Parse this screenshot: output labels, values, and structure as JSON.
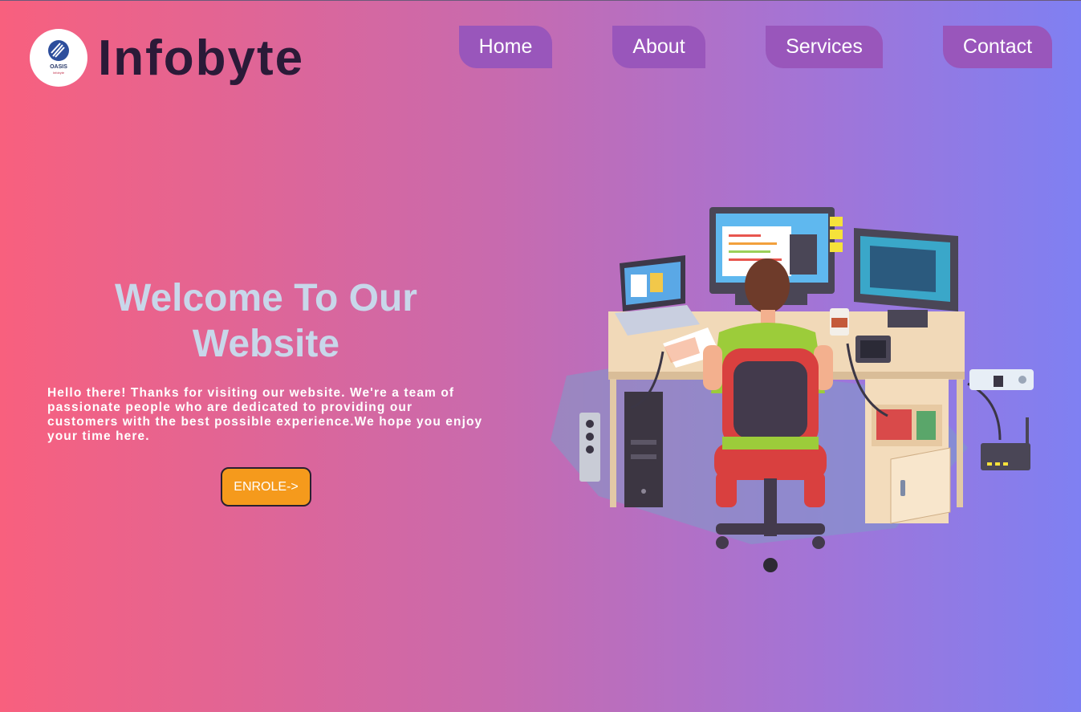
{
  "brand": {
    "name": "Infobyte",
    "logo_line1": "OASIS",
    "logo_line2": "Infobyte"
  },
  "nav": {
    "home": "Home",
    "about": "About",
    "services": "Services",
    "contact": "Contact"
  },
  "hero": {
    "title": "Welcome To Our Website",
    "description": "Hello there! Thanks for visiting our website. We're a team of passionate people who are dedicated to providing our customers with the best possible experience.We hope you enjoy your time here.",
    "button_label": "ENROLE->"
  },
  "colors": {
    "gradient_start": "#f8607e",
    "gradient_end": "#7f80f2",
    "nav_button": "#9956bb",
    "cta": "#f59a1c",
    "title": "#c8d7ea",
    "brand_text": "#2b1a38"
  },
  "illustration": {
    "icon": "developer-at-desk-illustration"
  }
}
